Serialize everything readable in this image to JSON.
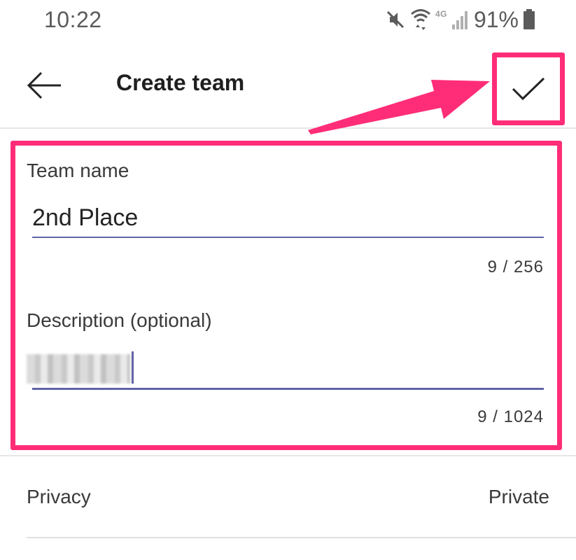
{
  "status_bar": {
    "time": "10:22",
    "network": "4G",
    "battery_percent": "91%",
    "icons": [
      "mute-icon",
      "wifi-icon",
      "signal-icon",
      "battery-icon"
    ]
  },
  "app_bar": {
    "title": "Create team",
    "back_icon": "arrow-left-icon",
    "confirm_icon": "checkmark-icon"
  },
  "form": {
    "team_name": {
      "label": "Team name",
      "value": "2nd Place",
      "count": "9 / 256"
    },
    "description": {
      "label": "Description (optional)",
      "count": "9 / 1024"
    }
  },
  "privacy": {
    "label": "Privacy",
    "value": "Private"
  },
  "colors": {
    "highlight": "#ff2d77",
    "accent": "#6264a7"
  }
}
